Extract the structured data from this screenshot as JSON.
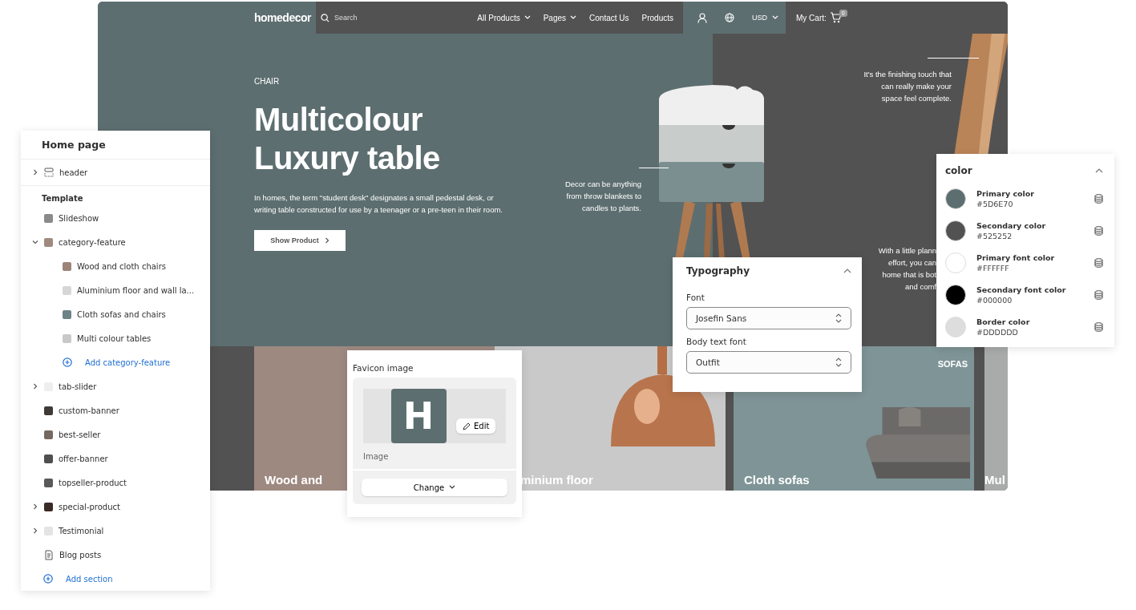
{
  "storefront": {
    "logo": "homedecor",
    "search": {
      "placeholder": "Search"
    },
    "menu": [
      {
        "label": "All Products",
        "dropdown": true
      },
      {
        "label": "Pages",
        "dropdown": true
      },
      {
        "label": "Contact Us",
        "dropdown": false
      },
      {
        "label": "Products",
        "dropdown": false
      }
    ],
    "currency": "USD",
    "cart": {
      "label": "My Cart:",
      "count": "0"
    },
    "hero": {
      "eyebrow": "CHAIR",
      "title": "Multicolour Luxury table",
      "description": "In homes, the term \"student desk\" designates a small pedestal desk, or writing table constructed for use by a teenager or a pre-teen in their room.",
      "button": "Show Product"
    },
    "callouts": [
      {
        "lines": [
          "Decor can be anything",
          "from throw blankets to",
          "candles to plants."
        ]
      },
      {
        "lines": [
          "It's the finishing touch that",
          "can really make your",
          "space feel complete."
        ]
      },
      {
        "lines": [
          "With a little plann",
          "effort, you can",
          "home that is bot",
          "and comf"
        ]
      }
    ],
    "categories": [
      {
        "kind": "chairs",
        "caption": "Wood and"
      },
      {
        "kind": "lamp",
        "caption": "minium floor"
      },
      {
        "kind": "sofa",
        "caption": "Cloth sofas",
        "tag": "SOFAS"
      },
      {
        "kind": "tables",
        "caption": "Mul"
      }
    ]
  },
  "editor": {
    "title": "Home page",
    "header": {
      "label": "header",
      "expanded": false
    },
    "template_label": "Template",
    "sections": [
      {
        "label": "Slideshow",
        "kind": "photo",
        "color": "#8a8a8a"
      },
      {
        "label": "category-feature",
        "kind": "photo",
        "expanded": true,
        "color": "#a08a80",
        "add_child": "Add category-feature",
        "children": [
          {
            "label": "Wood and cloth chairs",
            "color": "#9e8478"
          },
          {
            "label": "Aluminium floor and wall la...",
            "color": "#d6d6d6"
          },
          {
            "label": "Cloth sofas and chairs",
            "color": "#6d8385"
          },
          {
            "label": "Multi colour tables",
            "color": "#c9c9c9"
          }
        ]
      },
      {
        "label": "tab-slider",
        "kind": "photo",
        "expanded": false,
        "color": "#eeeeee"
      },
      {
        "label": "custom-banner",
        "kind": "photo",
        "color": "#3f3a36"
      },
      {
        "label": "best-seller",
        "kind": "photo",
        "color": "#76685e"
      },
      {
        "label": "offer-banner",
        "kind": "photo",
        "color": "#4f4f4f"
      },
      {
        "label": "topseller-product",
        "kind": "photo",
        "color": "#5a5a5a"
      },
      {
        "label": "special-product",
        "kind": "photo",
        "expanded": false,
        "color": "#3a2a25"
      },
      {
        "label": "Testimonial",
        "kind": "photo",
        "expanded": false,
        "color": "#e4e4e4"
      },
      {
        "label": "Blog posts",
        "kind": "document"
      }
    ],
    "add_section": "Add section"
  },
  "favicon": {
    "title": "Favicon image",
    "letter": "H",
    "edit": "Edit",
    "caption": "Image",
    "change": "Change"
  },
  "typography": {
    "title": "Typography",
    "expanded": true,
    "fields": [
      {
        "label": "Font",
        "value": "Josefin Sans"
      },
      {
        "label": "Body text font",
        "value": "Outfit"
      }
    ]
  },
  "colors": {
    "title": "color",
    "expanded": true,
    "items": [
      {
        "label": "Primary color",
        "value": "#5D6E70",
        "color": "#5d6e70"
      },
      {
        "label": "Secondary color",
        "value": "#525252",
        "color": "#525252"
      },
      {
        "label": "Primary font color",
        "value": "#FFFFFF",
        "color": "#ffffff"
      },
      {
        "label": "Secondary font color",
        "value": "#000000",
        "color": "#000000"
      },
      {
        "label": "Border color",
        "value": "#DDDDDD",
        "color": "#dddddd"
      }
    ]
  }
}
